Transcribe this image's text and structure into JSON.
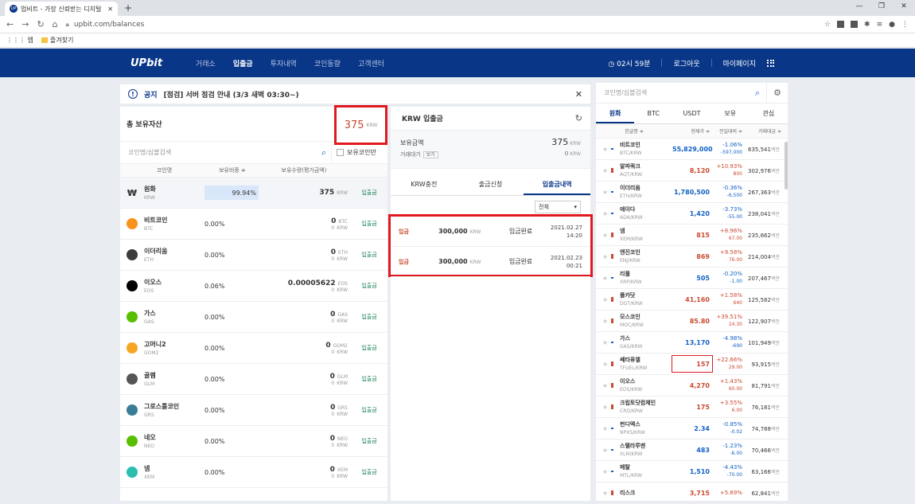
{
  "browser": {
    "tab_title": "업비트 - 가장 신뢰받는 디지털",
    "url": "upbit.com/balances",
    "bookmarks": [
      "앱",
      "즐겨찾기"
    ]
  },
  "gnb": {
    "logo": "UPbit",
    "menu": [
      "거래소",
      "입출금",
      "투자내역",
      "코인동향",
      "고객센터"
    ],
    "timer": "02시 59분",
    "logout": "로그아웃",
    "mypage": "마이페이지"
  },
  "notice": {
    "label": "공지",
    "message": "[점검] 서버 점검 안내 (3/3 새벽 03:30~)"
  },
  "assets": {
    "title": "총 보유자산",
    "total_value": "375",
    "total_unit": "KRW",
    "search_placeholder": "코인명/심볼검색",
    "owned_only": "보유코인만",
    "columns": [
      "코인명",
      "보유비중 ≑",
      "보유수량(평가금액)",
      ""
    ],
    "rows": [
      {
        "name": "원화",
        "sym": "KRW",
        "ratio": "99.94%",
        "qty": "375",
        "qty_unit": "KRW",
        "val": "",
        "val_unit": "",
        "action": "입출금",
        "color": "#ffffff"
      },
      {
        "name": "비트코인",
        "sym": "BTC",
        "ratio": "0.00%",
        "qty": "0",
        "qty_unit": "BTC",
        "val": "0",
        "val_unit": "KRW",
        "action": "입출금",
        "color": "#f7931a"
      },
      {
        "name": "이더리움",
        "sym": "ETH",
        "ratio": "0.00%",
        "qty": "0",
        "qty_unit": "ETH",
        "val": "0",
        "val_unit": "KRW",
        "action": "입출금",
        "color": "#3c3c3d"
      },
      {
        "name": "이오스",
        "sym": "EOS",
        "ratio": "0.06%",
        "qty": "0.00005622",
        "qty_unit": "EOS",
        "val": "0",
        "val_unit": "KRW",
        "action": "입출금",
        "color": "#000000"
      },
      {
        "name": "가스",
        "sym": "GAS",
        "ratio": "0.00%",
        "qty": "0",
        "qty_unit": "GAS",
        "val": "0",
        "val_unit": "KRW",
        "action": "입출금",
        "color": "#58bf00"
      },
      {
        "name": "고머니2",
        "sym": "GOM2",
        "ratio": "0.00%",
        "qty": "0",
        "qty_unit": "GOM2",
        "val": "0",
        "val_unit": "KRW",
        "action": "입출금",
        "color": "#f5a623"
      },
      {
        "name": "골렘",
        "sym": "GLM",
        "ratio": "0.00%",
        "qty": "0",
        "qty_unit": "GLM",
        "val": "0",
        "val_unit": "KRW",
        "action": "입출금",
        "color": "#555555"
      },
      {
        "name": "그로스톨코인",
        "sym": "GRS",
        "ratio": "0.00%",
        "qty": "0",
        "qty_unit": "GRS",
        "val": "0",
        "val_unit": "KRW",
        "action": "입출금",
        "color": "#377e96"
      },
      {
        "name": "네오",
        "sym": "NEO",
        "ratio": "0.00%",
        "qty": "0",
        "qty_unit": "NEO",
        "val": "0",
        "val_unit": "KRW",
        "action": "입출금",
        "color": "#58bf00"
      },
      {
        "name": "넴",
        "sym": "XEM",
        "ratio": "0.00%",
        "qty": "0",
        "qty_unit": "XEM",
        "val": "0",
        "val_unit": "KRW",
        "action": "입출금",
        "color": "#2bbdb0"
      }
    ]
  },
  "krw": {
    "title": "KRW 입출금",
    "balance_label": "보유금액",
    "balance": "375",
    "pending_label": "거래대기",
    "pending_btn": "보기",
    "pending": "0",
    "unit": "KRW",
    "tabs": [
      "KRW충전",
      "출금신청",
      "입출금내역"
    ],
    "filter": "전체",
    "history": [
      {
        "type": "입금",
        "amount": "300,000",
        "unit": "KRW",
        "status": "입금완료",
        "date": "2021.02.27",
        "time": "14:20"
      },
      {
        "type": "입금",
        "amount": "300,000",
        "unit": "KRW",
        "status": "입금완료",
        "date": "2021.02.23",
        "time": "00:21"
      }
    ]
  },
  "market": {
    "search_placeholder": "코인명/심볼검색",
    "tabs": [
      "원화",
      "BTC",
      "USDT",
      "보유",
      "관심"
    ],
    "columns": [
      "한글명 ≑",
      "현재가 ≑",
      "전일대비 ≑",
      "거래대금 ≑"
    ],
    "rows": [
      {
        "name": "비트코인",
        "pair": "BTC/KRW",
        "price": "55,829,000",
        "pct": "-1.06%",
        "chg": "-597,000",
        "vol": "635,541",
        "dir": "dn"
      },
      {
        "name": "알파쿼크",
        "pair": "AQT/KRW",
        "price": "8,120",
        "pct": "+10.93%",
        "chg": "800",
        "vol": "302,976",
        "dir": "up"
      },
      {
        "name": "이더리움",
        "pair": "ETH/KRW",
        "price": "1,780,500",
        "pct": "-0.36%",
        "chg": "-6,500",
        "vol": "267,363",
        "dir": "dn"
      },
      {
        "name": "에이다",
        "pair": "ADA/KRW",
        "price": "1,420",
        "pct": "-3.73%",
        "chg": "-55.00",
        "vol": "238,041",
        "dir": "dn"
      },
      {
        "name": "넴",
        "pair": "XEM/KRW",
        "price": "815",
        "pct": "+8.96%",
        "chg": "67.00",
        "vol": "235,662",
        "dir": "up"
      },
      {
        "name": "엔진코인",
        "pair": "ENJ/KRW",
        "price": "869",
        "pct": "+9.58%",
        "chg": "76.00",
        "vol": "214,004",
        "dir": "up"
      },
      {
        "name": "리플",
        "pair": "XRP/KRW",
        "price": "505",
        "pct": "-0.20%",
        "chg": "-1.00",
        "vol": "207,467",
        "dir": "dn"
      },
      {
        "name": "폴카닷",
        "pair": "DOT/KRW",
        "price": "41,160",
        "pct": "+1.58%",
        "chg": "640",
        "vol": "125,582",
        "dir": "up"
      },
      {
        "name": "모스코인",
        "pair": "MOC/KRW",
        "price": "85.80",
        "pct": "+39.51%",
        "chg": "24.30",
        "vol": "122,907",
        "dir": "up"
      },
      {
        "name": "가스",
        "pair": "GAS/KRW",
        "price": "13,170",
        "pct": "-4.98%",
        "chg": "-690",
        "vol": "101,949",
        "dir": "dn"
      },
      {
        "name": "쎄타퓨엘",
        "pair": "TFUEL/KRW",
        "price": "157",
        "pct": "+22.66%",
        "chg": "29.00",
        "vol": "93,915",
        "dir": "up"
      },
      {
        "name": "이오스",
        "pair": "EOS/KRW",
        "price": "4,270",
        "pct": "+1.43%",
        "chg": "60.00",
        "vol": "81,791",
        "dir": "up"
      },
      {
        "name": "크립토닷컴체인",
        "pair": "CRO/KRW",
        "price": "175",
        "pct": "+3.55%",
        "chg": "6.00",
        "vol": "76,181",
        "dir": "up"
      },
      {
        "name": "펀디엑스",
        "pair": "NPXS/KRW",
        "price": "2.34",
        "pct": "-0.85%",
        "chg": "-0.02",
        "vol": "74,788",
        "dir": "dn"
      },
      {
        "name": "스텔라루멘",
        "pair": "XLM/KRW",
        "price": "483",
        "pct": "-1.23%",
        "chg": "-6.00",
        "vol": "70,466",
        "dir": "dn"
      },
      {
        "name": "메탈",
        "pair": "MTL/KRW",
        "price": "1,510",
        "pct": "-4.43%",
        "chg": "-70.00",
        "vol": "63,166",
        "dir": "dn"
      },
      {
        "name": "리스크",
        "pair": "",
        "price": "3,715",
        "pct": "+5.69%",
        "chg": "",
        "vol": "62,841",
        "dir": "up"
      }
    ],
    "vol_unit": "백만"
  }
}
